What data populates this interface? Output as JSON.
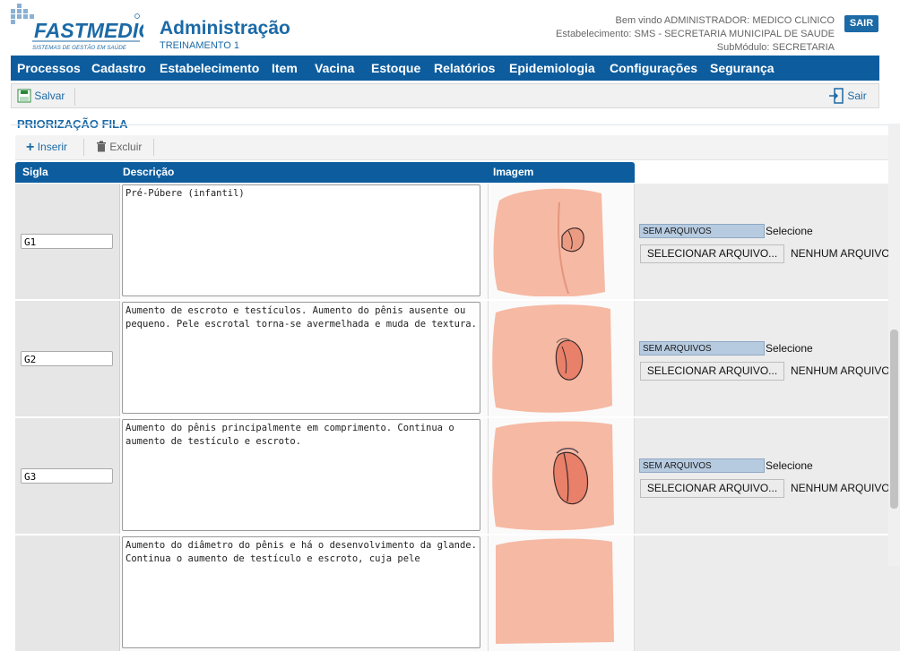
{
  "header": {
    "brand": "FASTMEDIC",
    "brand_tagline": "SISTEMAS DE GESTÃO EM SAÚDE",
    "title": "Administração",
    "subtitle": "TREINAMENTO 1",
    "welcome": "Bem vindo ADMINISTRADOR: MEDICO CLINICO",
    "establishment": "Estabelecimento: SMS - SECRETARIA MUNICIPAL DE SAUDE",
    "submodule": "SubMódulo: SECRETARIA",
    "logout_label": "SAIR"
  },
  "menu": [
    "Processos",
    "Cadastro",
    "Estabelecimento",
    "Item",
    "Vacina",
    "Estoque",
    "Relatórios",
    "Epidemiologia",
    "Configurações",
    "Segurança"
  ],
  "toolbar": {
    "save_label": "Salvar",
    "exit_label": "Sair"
  },
  "section": {
    "title": "PRIORIZAÇÃO FILA"
  },
  "subtoolbar": {
    "insert_label": "Inserir",
    "delete_label": "Excluir"
  },
  "grid": {
    "columns": [
      "Sigla",
      "Descrição",
      "Imagem"
    ],
    "rows": [
      {
        "sigla": "G1",
        "descricao": "Pré-Púbere (infantil)",
        "file_status": "SEM ARQUIVOS",
        "select_text": "Selecione",
        "button_label": "SELECIONAR ARQUIVO...",
        "no_file": "NENHUM ARQUIVO"
      },
      {
        "sigla": "G2",
        "descricao": "Aumento de escroto e testículos. Aumento do pênis ausente ou pequeno. Pele escrotal torna-se avermelhada e muda de textura.",
        "file_status": "SEM ARQUIVOS",
        "select_text": "Selecione",
        "button_label": "SELECIONAR ARQUIVO...",
        "no_file": "NENHUM ARQUIVO"
      },
      {
        "sigla": "G3",
        "descricao": "Aumento do pênis principalmente em comprimento. Continua o aumento de testículo e escroto.",
        "file_status": "SEM ARQUIVOS",
        "select_text": "Selecione",
        "button_label": "SELECIONAR ARQUIVO...",
        "no_file": "NENHUM ARQUIVO"
      },
      {
        "sigla": "",
        "descricao": "Aumento do diâmetro do pênis e há o desenvolvimento da glande. Continua o aumento de testículo e escroto, cuja pele",
        "file_status": "",
        "select_text": "",
        "button_label": "",
        "no_file": ""
      }
    ]
  },
  "colors": {
    "primary": "#0d5d9e",
    "title": "#1c6aa6",
    "skin": "#f5b39e"
  }
}
